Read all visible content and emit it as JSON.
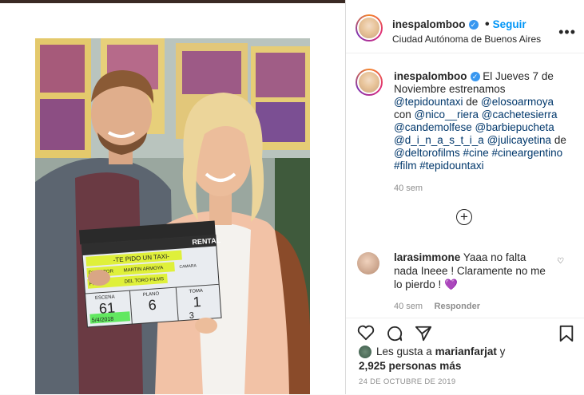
{
  "post": {
    "username": "inespalomboo",
    "follow_label": "Seguir",
    "location": "Ciudad Autónoma de Buenos Aires",
    "caption": {
      "username": "inespalomboo",
      "lines": [
        {
          "segments": [
            {
              "text": "El Jueves 7 de",
              "type": "text"
            }
          ]
        },
        {
          "segments": [
            {
              "text": "Noviembre estrenamos",
              "type": "text"
            }
          ]
        },
        {
          "segments": [
            {
              "text": "@tepidountaxi",
              "type": "tag"
            },
            {
              "text": " de ",
              "type": "text"
            },
            {
              "text": "@elosoarmoya",
              "type": "tag"
            }
          ]
        },
        {
          "segments": [
            {
              "text": "con ",
              "type": "text"
            },
            {
              "text": "@nico__riera",
              "type": "tag"
            },
            {
              "text": " ",
              "type": "text"
            },
            {
              "text": "@cachetesierra",
              "type": "tag"
            }
          ]
        },
        {
          "segments": [
            {
              "text": "@candemolfese",
              "type": "tag"
            },
            {
              "text": " ",
              "type": "text"
            },
            {
              "text": "@barbiepucheta",
              "type": "tag"
            }
          ]
        },
        {
          "segments": [
            {
              "text": "@d_i_n_a_s_t_i_a",
              "type": "tag"
            },
            {
              "text": " ",
              "type": "text"
            },
            {
              "text": "@julicayetina",
              "type": "tag"
            },
            {
              "text": " de",
              "type": "text"
            }
          ]
        },
        {
          "segments": [
            {
              "text": "@deltorofilms",
              "type": "tag"
            },
            {
              "text": " ",
              "type": "text"
            },
            {
              "text": "#cine",
              "type": "tag"
            },
            {
              "text": " ",
              "type": "text"
            },
            {
              "text": "#cineargentino",
              "type": "tag"
            }
          ]
        },
        {
          "segments": [
            {
              "text": "#film",
              "type": "tag"
            },
            {
              "text": " ",
              "type": "text"
            },
            {
              "text": "#tepidountaxi",
              "type": "tag"
            }
          ]
        }
      ],
      "time": "40 sem"
    },
    "comment": {
      "username": "larasimmone",
      "text_line1": "Yaaa no falta",
      "text_line2": "nada Ineee ! Claramente no me",
      "text_line3": "lo pierdo !",
      "emoji": "💜",
      "time": "40 sem",
      "reply_label": "Responder"
    },
    "likes": {
      "prefix": "Les gusta a ",
      "user": "marianfarjat",
      "suffix": " y",
      "count": "2,925 personas más"
    },
    "date": "24 DE OCTUBRE DE 2019"
  },
  "clapperboard": {
    "rental": "RENTAL",
    "title": "-TE PIDO UN TAXI-",
    "director_label": "DIRECTOR",
    "director": "MARTIN ARMOYA",
    "camera_label": "CAMARA",
    "prod_label": "PROD.",
    "prod": "DEL TORO FILMS",
    "escena_label": "ESCENA",
    "escena": "61",
    "plano_label": "PLANO",
    "plano": "6",
    "toma_label": "TOMA",
    "toma": "1",
    "date": "5/4/2018",
    "sound": "3"
  }
}
